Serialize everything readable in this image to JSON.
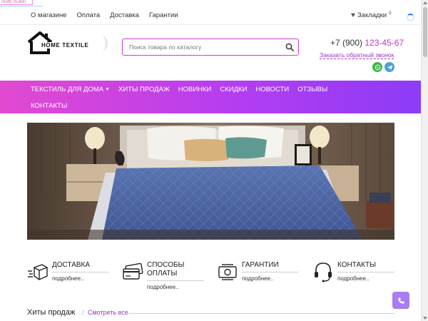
{
  "debug_tag": "(0x00 0x264)",
  "top_nav": {
    "items": [
      "О магазине",
      "Оплата",
      "Доставка",
      "Гарантии"
    ],
    "bookmarks_label": "Закладки",
    "bookmarks_count": "0"
  },
  "logo": {
    "text": "HOME TEXTILE"
  },
  "search": {
    "placeholder": "Поиск товара по каталогу"
  },
  "contacts": {
    "phone_prefix": "+7 (900)",
    "phone_number": "123-45-67",
    "callback_label": "Заказать обратный звонок"
  },
  "menu": {
    "row1": [
      "Текстиль для дома",
      "Хиты продаж",
      "Новинки",
      "Скидки",
      "Новости",
      "Отзывы"
    ],
    "row2": [
      "Контакты"
    ]
  },
  "features": [
    {
      "icon": "delivery-box-icon",
      "title_lines": [
        "Доставка"
      ],
      "more": "подробнее.."
    },
    {
      "icon": "credit-cards-icon",
      "title_lines": [
        "Способы",
        "оплаты"
      ],
      "more": "подробнее.."
    },
    {
      "icon": "cash-guarantee-icon",
      "title_lines": [
        "Гарантии"
      ],
      "more": "подробнее.."
    },
    {
      "icon": "headset-icon",
      "title_lines": [
        "Контакты"
      ],
      "more": "подробнее.."
    }
  ],
  "hits": {
    "title": "Хиты продаж",
    "separator": "/",
    "see_all": "Смотреть все"
  },
  "colors": {
    "accent": "#c432c6",
    "menu_gradient_start": "#e24ad0",
    "menu_gradient_end": "#8c3cf7",
    "whatsapp": "#3cb54a",
    "telegram": "#4f9ee0",
    "call_button": "#a97cf2"
  }
}
